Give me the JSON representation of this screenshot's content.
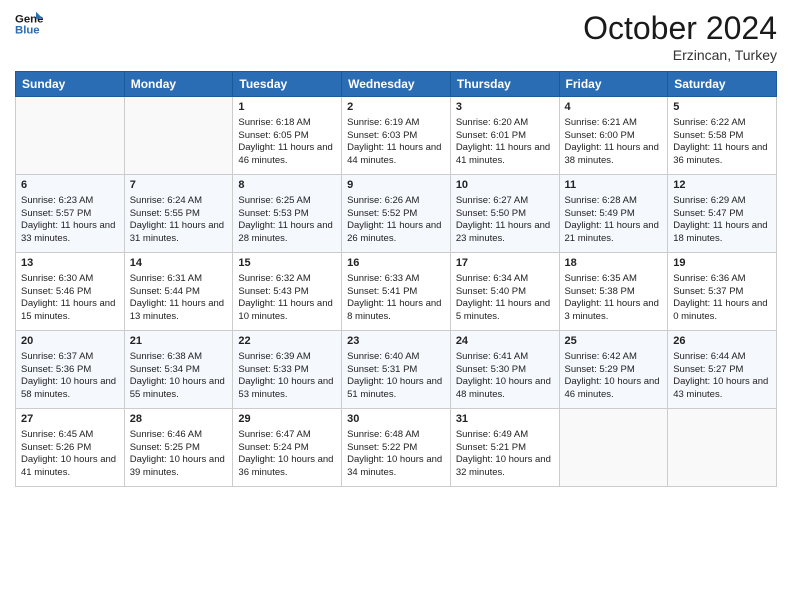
{
  "logo": {
    "line1": "General",
    "line2": "Blue"
  },
  "title": "October 2024",
  "subtitle": "Erzincan, Turkey",
  "days_header": [
    "Sunday",
    "Monday",
    "Tuesday",
    "Wednesday",
    "Thursday",
    "Friday",
    "Saturday"
  ],
  "weeks": [
    [
      {
        "day": "",
        "sunrise": "",
        "sunset": "",
        "daylight": ""
      },
      {
        "day": "",
        "sunrise": "",
        "sunset": "",
        "daylight": ""
      },
      {
        "day": "1",
        "sunrise": "Sunrise: 6:18 AM",
        "sunset": "Sunset: 6:05 PM",
        "daylight": "Daylight: 11 hours and 46 minutes."
      },
      {
        "day": "2",
        "sunrise": "Sunrise: 6:19 AM",
        "sunset": "Sunset: 6:03 PM",
        "daylight": "Daylight: 11 hours and 44 minutes."
      },
      {
        "day": "3",
        "sunrise": "Sunrise: 6:20 AM",
        "sunset": "Sunset: 6:01 PM",
        "daylight": "Daylight: 11 hours and 41 minutes."
      },
      {
        "day": "4",
        "sunrise": "Sunrise: 6:21 AM",
        "sunset": "Sunset: 6:00 PM",
        "daylight": "Daylight: 11 hours and 38 minutes."
      },
      {
        "day": "5",
        "sunrise": "Sunrise: 6:22 AM",
        "sunset": "Sunset: 5:58 PM",
        "daylight": "Daylight: 11 hours and 36 minutes."
      }
    ],
    [
      {
        "day": "6",
        "sunrise": "Sunrise: 6:23 AM",
        "sunset": "Sunset: 5:57 PM",
        "daylight": "Daylight: 11 hours and 33 minutes."
      },
      {
        "day": "7",
        "sunrise": "Sunrise: 6:24 AM",
        "sunset": "Sunset: 5:55 PM",
        "daylight": "Daylight: 11 hours and 31 minutes."
      },
      {
        "day": "8",
        "sunrise": "Sunrise: 6:25 AM",
        "sunset": "Sunset: 5:53 PM",
        "daylight": "Daylight: 11 hours and 28 minutes."
      },
      {
        "day": "9",
        "sunrise": "Sunrise: 6:26 AM",
        "sunset": "Sunset: 5:52 PM",
        "daylight": "Daylight: 11 hours and 26 minutes."
      },
      {
        "day": "10",
        "sunrise": "Sunrise: 6:27 AM",
        "sunset": "Sunset: 5:50 PM",
        "daylight": "Daylight: 11 hours and 23 minutes."
      },
      {
        "day": "11",
        "sunrise": "Sunrise: 6:28 AM",
        "sunset": "Sunset: 5:49 PM",
        "daylight": "Daylight: 11 hours and 21 minutes."
      },
      {
        "day": "12",
        "sunrise": "Sunrise: 6:29 AM",
        "sunset": "Sunset: 5:47 PM",
        "daylight": "Daylight: 11 hours and 18 minutes."
      }
    ],
    [
      {
        "day": "13",
        "sunrise": "Sunrise: 6:30 AM",
        "sunset": "Sunset: 5:46 PM",
        "daylight": "Daylight: 11 hours and 15 minutes."
      },
      {
        "day": "14",
        "sunrise": "Sunrise: 6:31 AM",
        "sunset": "Sunset: 5:44 PM",
        "daylight": "Daylight: 11 hours and 13 minutes."
      },
      {
        "day": "15",
        "sunrise": "Sunrise: 6:32 AM",
        "sunset": "Sunset: 5:43 PM",
        "daylight": "Daylight: 11 hours and 10 minutes."
      },
      {
        "day": "16",
        "sunrise": "Sunrise: 6:33 AM",
        "sunset": "Sunset: 5:41 PM",
        "daylight": "Daylight: 11 hours and 8 minutes."
      },
      {
        "day": "17",
        "sunrise": "Sunrise: 6:34 AM",
        "sunset": "Sunset: 5:40 PM",
        "daylight": "Daylight: 11 hours and 5 minutes."
      },
      {
        "day": "18",
        "sunrise": "Sunrise: 6:35 AM",
        "sunset": "Sunset: 5:38 PM",
        "daylight": "Daylight: 11 hours and 3 minutes."
      },
      {
        "day": "19",
        "sunrise": "Sunrise: 6:36 AM",
        "sunset": "Sunset: 5:37 PM",
        "daylight": "Daylight: 11 hours and 0 minutes."
      }
    ],
    [
      {
        "day": "20",
        "sunrise": "Sunrise: 6:37 AM",
        "sunset": "Sunset: 5:36 PM",
        "daylight": "Daylight: 10 hours and 58 minutes."
      },
      {
        "day": "21",
        "sunrise": "Sunrise: 6:38 AM",
        "sunset": "Sunset: 5:34 PM",
        "daylight": "Daylight: 10 hours and 55 minutes."
      },
      {
        "day": "22",
        "sunrise": "Sunrise: 6:39 AM",
        "sunset": "Sunset: 5:33 PM",
        "daylight": "Daylight: 10 hours and 53 minutes."
      },
      {
        "day": "23",
        "sunrise": "Sunrise: 6:40 AM",
        "sunset": "Sunset: 5:31 PM",
        "daylight": "Daylight: 10 hours and 51 minutes."
      },
      {
        "day": "24",
        "sunrise": "Sunrise: 6:41 AM",
        "sunset": "Sunset: 5:30 PM",
        "daylight": "Daylight: 10 hours and 48 minutes."
      },
      {
        "day": "25",
        "sunrise": "Sunrise: 6:42 AM",
        "sunset": "Sunset: 5:29 PM",
        "daylight": "Daylight: 10 hours and 46 minutes."
      },
      {
        "day": "26",
        "sunrise": "Sunrise: 6:44 AM",
        "sunset": "Sunset: 5:27 PM",
        "daylight": "Daylight: 10 hours and 43 minutes."
      }
    ],
    [
      {
        "day": "27",
        "sunrise": "Sunrise: 6:45 AM",
        "sunset": "Sunset: 5:26 PM",
        "daylight": "Daylight: 10 hours and 41 minutes."
      },
      {
        "day": "28",
        "sunrise": "Sunrise: 6:46 AM",
        "sunset": "Sunset: 5:25 PM",
        "daylight": "Daylight: 10 hours and 39 minutes."
      },
      {
        "day": "29",
        "sunrise": "Sunrise: 6:47 AM",
        "sunset": "Sunset: 5:24 PM",
        "daylight": "Daylight: 10 hours and 36 minutes."
      },
      {
        "day": "30",
        "sunrise": "Sunrise: 6:48 AM",
        "sunset": "Sunset: 5:22 PM",
        "daylight": "Daylight: 10 hours and 34 minutes."
      },
      {
        "day": "31",
        "sunrise": "Sunrise: 6:49 AM",
        "sunset": "Sunset: 5:21 PM",
        "daylight": "Daylight: 10 hours and 32 minutes."
      },
      {
        "day": "",
        "sunrise": "",
        "sunset": "",
        "daylight": ""
      },
      {
        "day": "",
        "sunrise": "",
        "sunset": "",
        "daylight": ""
      }
    ]
  ]
}
